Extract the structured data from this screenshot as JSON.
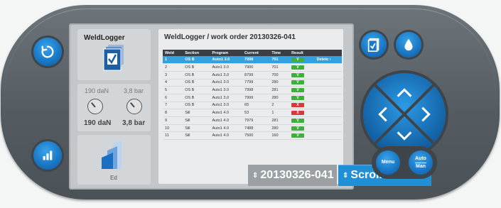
{
  "app": {
    "title": "WeldLogger"
  },
  "colors": {
    "accent_blue": "#1f8fd6",
    "ok_green": "#3fae3d",
    "fail_red": "#d33b3b",
    "header_dark": "#3b3f44"
  },
  "gauges": {
    "force_label": "190 daN",
    "pressure_label": "3,8 bar",
    "force_value": "190 daN",
    "pressure_value": "3,8 bar"
  },
  "mode_tile": {
    "label": "Ed"
  },
  "main": {
    "title": "WeldLogger / work order 20130326-041",
    "columns": [
      "Weld",
      "Section",
      "Program",
      "Current",
      "Time",
      "Result"
    ],
    "rows": [
      {
        "weld": "1",
        "section": "OS B",
        "program": "Auto1 3.0",
        "current": "7998",
        "time": "701",
        "result": "V",
        "ok": true,
        "selected": true,
        "action": "Delete"
      },
      {
        "weld": "2",
        "section": "OS B",
        "program": "Auto1 3.0",
        "current": "7900",
        "time": "701",
        "result": "V",
        "ok": true
      },
      {
        "weld": "3",
        "section": "OS B",
        "program": "Auto1 3.0",
        "current": "8799",
        "time": "700",
        "result": "V",
        "ok": true
      },
      {
        "weld": "4",
        "section": "OS B",
        "program": "Auto1 3.0",
        "current": "7799",
        "time": "280",
        "result": "V",
        "ok": true
      },
      {
        "weld": "5",
        "section": "OS B",
        "program": "Auto1 3.0",
        "current": "7998",
        "time": "281",
        "result": "V",
        "ok": true
      },
      {
        "weld": "6",
        "section": "OS B",
        "program": "Auto1 3.0",
        "current": "7999",
        "time": "280",
        "result": "V",
        "ok": true
      },
      {
        "weld": "7",
        "section": "OS B",
        "program": "Auto1 3.0",
        "current": "65",
        "time": "2",
        "result": "X",
        "ok": false
      },
      {
        "weld": "8",
        "section": "Sill",
        "program": "Auto1 4.0",
        "current": "53",
        "time": "1",
        "result": "X",
        "ok": false
      },
      {
        "weld": "9",
        "section": "Sill",
        "program": "Auto1 4.0",
        "current": "7979",
        "time": "281",
        "result": "V",
        "ok": true
      },
      {
        "weld": "10",
        "section": "Sill",
        "program": "Auto1 4.0",
        "current": "7488",
        "time": "280",
        "result": "V",
        "ok": true
      },
      {
        "weld": "11",
        "section": "Sill",
        "program": "Auto1 4.0",
        "current": "7500",
        "time": "160",
        "result": "V",
        "ok": true
      }
    ],
    "order_value": "20130326-041",
    "scroll_label": "Scroll"
  },
  "buttons": {
    "menu": "Menu",
    "auto": "Auto",
    "man": "Man"
  },
  "icons": {
    "left_top": "refresh-icon",
    "left_bottom": "bar-chart-icon",
    "right_doc": "document-check-icon",
    "right_drop": "water-drop-icon"
  }
}
